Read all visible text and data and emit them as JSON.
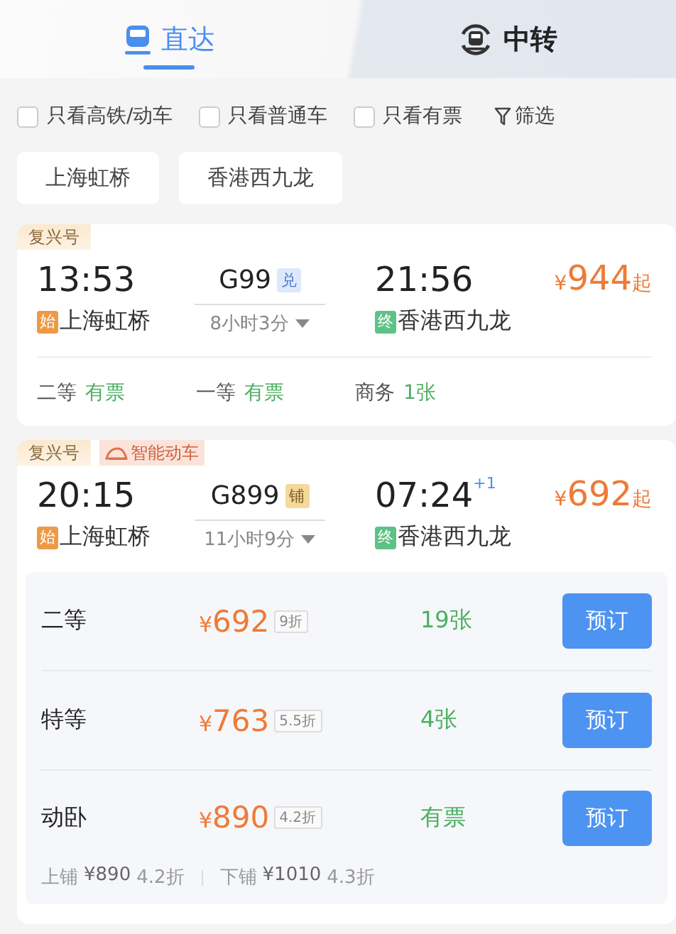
{
  "tabs": [
    {
      "label": "直达",
      "selected": true,
      "kind": "direct"
    },
    {
      "label": "中转",
      "selected": false,
      "kind": "transfer"
    }
  ],
  "filters": [
    {
      "label": "只看高铁/动车",
      "checked": false
    },
    {
      "label": "只看普通车",
      "checked": false
    },
    {
      "label": "只看有票",
      "checked": false
    }
  ],
  "filter_button": "筛选",
  "stations": [
    "上海虹桥",
    "香港西九龙"
  ],
  "trains": [
    {
      "tags": [
        {
          "text": "复兴号",
          "kind": "model"
        }
      ],
      "depart_time": "13:53",
      "train_no": "G99",
      "badge": {
        "text": "兑",
        "kind": "exchange"
      },
      "arrive_time": "21:56",
      "price_symbol": "¥",
      "price": "944",
      "price_suffix": "起",
      "from_mark": "始",
      "from": "上海虹桥",
      "duration": "8小时3分",
      "to_mark": "终",
      "to": "香港西九龙",
      "expanded": false,
      "seats": [
        {
          "class": "二等",
          "availability": "有票"
        },
        {
          "class": "一等",
          "availability": "有票"
        },
        {
          "class": "商务",
          "availability": "1张"
        }
      ]
    },
    {
      "tags": [
        {
          "text": "复兴号",
          "kind": "model"
        },
        {
          "text": "智能动车",
          "kind": "smart"
        }
      ],
      "depart_time": "20:15",
      "train_no": "G899",
      "badge": {
        "text": "铺",
        "kind": "berth"
      },
      "arrive_time": "07:24",
      "day_offset": "+1",
      "price_symbol": "¥",
      "price": "692",
      "price_suffix": "起",
      "from_mark": "始",
      "from": "上海虹桥",
      "duration": "11小时9分",
      "to_mark": "终",
      "to": "香港西九龙",
      "expanded": true,
      "options": [
        {
          "class": "二等",
          "price_symbol": "¥",
          "price": "692",
          "discount": "9折",
          "remaining": "19张",
          "button": "预订"
        },
        {
          "class": "特等",
          "price_symbol": "¥",
          "price": "763",
          "discount": "5.5折",
          "remaining": "4张",
          "button": "预订"
        },
        {
          "class": "动卧",
          "price_symbol": "¥",
          "price": "890",
          "discount": "4.2折",
          "remaining": "有票",
          "button": "预订"
        }
      ],
      "berths": [
        {
          "label": "上铺",
          "price": "¥890",
          "discount": "4.2折"
        },
        {
          "label": "下铺",
          "price": "¥1010",
          "discount": "4.3折"
        }
      ]
    }
  ]
}
